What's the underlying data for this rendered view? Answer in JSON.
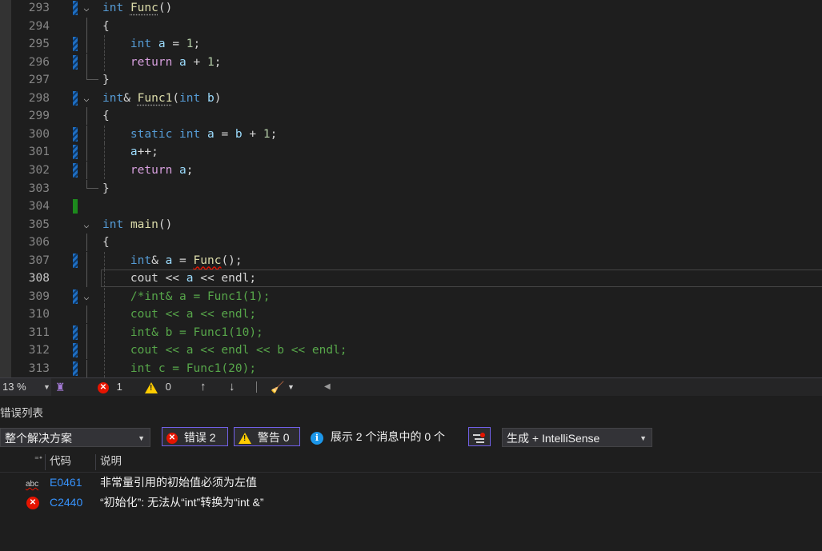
{
  "editor": {
    "lines": [
      {
        "n": "293",
        "tokens": [
          {
            "t": "int",
            "c": "kw"
          },
          {
            "t": " ",
            "c": "pl"
          },
          {
            "t": "Func",
            "c": "fn",
            "u": "dots"
          },
          {
            "t": "()",
            "c": "pl"
          }
        ]
      },
      {
        "n": "294",
        "tokens": [
          {
            "t": "{",
            "c": "pl"
          }
        ]
      },
      {
        "n": "295",
        "tokens": [
          {
            "t": "    ",
            "c": "pl"
          },
          {
            "t": "int",
            "c": "kw"
          },
          {
            "t": " ",
            "c": "pl"
          },
          {
            "t": "a",
            "c": "id"
          },
          {
            "t": " = ",
            "c": "pl"
          },
          {
            "t": "1",
            "c": "num"
          },
          {
            "t": ";",
            "c": "pl"
          }
        ]
      },
      {
        "n": "296",
        "tokens": [
          {
            "t": "    ",
            "c": "pl"
          },
          {
            "t": "return",
            "c": "ctl"
          },
          {
            "t": " ",
            "c": "pl"
          },
          {
            "t": "a",
            "c": "id"
          },
          {
            "t": " + ",
            "c": "pl"
          },
          {
            "t": "1",
            "c": "num"
          },
          {
            "t": ";",
            "c": "pl"
          }
        ]
      },
      {
        "n": "297",
        "tokens": [
          {
            "t": "}",
            "c": "pl"
          }
        ]
      },
      {
        "n": "298",
        "tokens": [
          {
            "t": "int",
            "c": "kw"
          },
          {
            "t": "& ",
            "c": "pl"
          },
          {
            "t": "Func1",
            "c": "fn",
            "u": "dots"
          },
          {
            "t": "(",
            "c": "pl"
          },
          {
            "t": "int",
            "c": "kw"
          },
          {
            "t": " ",
            "c": "pl"
          },
          {
            "t": "b",
            "c": "id"
          },
          {
            "t": ")",
            "c": "pl"
          }
        ]
      },
      {
        "n": "299",
        "tokens": [
          {
            "t": "{",
            "c": "pl"
          }
        ]
      },
      {
        "n": "300",
        "tokens": [
          {
            "t": "    ",
            "c": "pl"
          },
          {
            "t": "static",
            "c": "kw"
          },
          {
            "t": " ",
            "c": "pl"
          },
          {
            "t": "int",
            "c": "kw"
          },
          {
            "t": " ",
            "c": "pl"
          },
          {
            "t": "a",
            "c": "id"
          },
          {
            "t": " = ",
            "c": "pl"
          },
          {
            "t": "b",
            "c": "id"
          },
          {
            "t": " + ",
            "c": "pl"
          },
          {
            "t": "1",
            "c": "num"
          },
          {
            "t": ";",
            "c": "pl"
          }
        ]
      },
      {
        "n": "301",
        "tokens": [
          {
            "t": "    ",
            "c": "pl"
          },
          {
            "t": "a",
            "c": "id"
          },
          {
            "t": "++;",
            "c": "pl"
          }
        ]
      },
      {
        "n": "302",
        "tokens": [
          {
            "t": "    ",
            "c": "pl"
          },
          {
            "t": "return",
            "c": "ctl"
          },
          {
            "t": " ",
            "c": "pl"
          },
          {
            "t": "a",
            "c": "id"
          },
          {
            "t": ";",
            "c": "pl"
          }
        ]
      },
      {
        "n": "303",
        "tokens": [
          {
            "t": "}",
            "c": "pl"
          }
        ]
      },
      {
        "n": "304",
        "tokens": []
      },
      {
        "n": "305",
        "tokens": [
          {
            "t": "int",
            "c": "kw"
          },
          {
            "t": " ",
            "c": "pl"
          },
          {
            "t": "main",
            "c": "fn"
          },
          {
            "t": "()",
            "c": "pl"
          }
        ]
      },
      {
        "n": "306",
        "tokens": [
          {
            "t": "{",
            "c": "pl"
          }
        ]
      },
      {
        "n": "307",
        "tokens": [
          {
            "t": "    ",
            "c": "pl"
          },
          {
            "t": "int",
            "c": "kw"
          },
          {
            "t": "& ",
            "c": "pl"
          },
          {
            "t": "a",
            "c": "id"
          },
          {
            "t": " = ",
            "c": "pl"
          },
          {
            "t": "Func",
            "c": "fn",
            "u": "squig"
          },
          {
            "t": "();",
            "c": "pl"
          }
        ]
      },
      {
        "n": "308",
        "tokens": [
          {
            "t": "    cout << ",
            "c": "pl"
          },
          {
            "t": "a",
            "c": "id"
          },
          {
            "t": " << endl;",
            "c": "pl"
          }
        ]
      },
      {
        "n": "309",
        "tokens": [
          {
            "t": "    /*int& a = Func1(1);",
            "c": "cm"
          }
        ]
      },
      {
        "n": "310",
        "tokens": [
          {
            "t": "    cout << a << endl;",
            "c": "cm"
          }
        ]
      },
      {
        "n": "311",
        "tokens": [
          {
            "t": "    int& b = Func1(10);",
            "c": "cm"
          }
        ]
      },
      {
        "n": "312",
        "tokens": [
          {
            "t": "    cout << a << endl << b << endl;",
            "c": "cm"
          }
        ]
      },
      {
        "n": "313",
        "tokens": [
          {
            "t": "    int c = Func1(20);",
            "c": "cm"
          }
        ]
      }
    ]
  },
  "statusbar": {
    "zoom": "13 %",
    "error_count": "1",
    "warning_count": "0"
  },
  "error_list": {
    "title": "错误列表",
    "scope": "整个解决方案",
    "errors_toggle": "错误 2",
    "warnings_toggle": "警告 0",
    "messages_text": "展示 2 个消息中的 0 个",
    "build_filter": "生成 + IntelliSense",
    "col_code": "代码",
    "col_desc": "说明",
    "rows": [
      {
        "icon": "abc",
        "code": "E0461",
        "desc": "非常量引用的初始值必须为左值"
      },
      {
        "icon": "error",
        "code": "C2440",
        "desc": "“初始化”: 无法从“int”转换为“int &”"
      }
    ]
  },
  "colors": {
    "editor_bg": "#1e1e1e",
    "keyword": "#569cd6",
    "function": "#dcdcaa",
    "comment": "#57a64a",
    "error": "#e51400",
    "link": "#3794ff",
    "toggle_border": "#7160e8"
  }
}
